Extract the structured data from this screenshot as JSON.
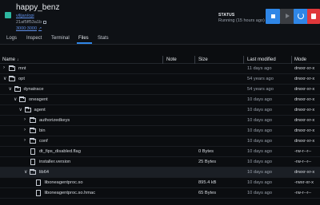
{
  "container": {
    "name": "happy_benz",
    "image": "vilijan/opi",
    "id": "21af5ff53a1b",
    "port": "3000:3000"
  },
  "status": {
    "label": "STATUS",
    "value": "Running (15 hours ago)"
  },
  "actions": {
    "stop": "stop-icon",
    "start": "play-icon",
    "restart": "restart-icon",
    "delete": "trash-icon"
  },
  "tabs": [
    "Logs",
    "Inspect",
    "Terminal",
    "Files",
    "Stats"
  ],
  "active_tab": "Files",
  "columns": {
    "name": "Name",
    "note": "Note",
    "size": "Size",
    "last_modified": "Last modified",
    "mode": "Mode"
  },
  "rows": [
    {
      "name": "mnt",
      "type": "folder",
      "expanded": false,
      "size": "",
      "modified": "11 days ago",
      "mode": "drwxr-xr-x"
    },
    {
      "name": "opt",
      "type": "folder",
      "expanded": true,
      "size": "",
      "modified": "54 years ago",
      "mode": "drwxr-xr-x"
    },
    {
      "name": "dynatrace",
      "type": "folder",
      "expanded": true,
      "size": "",
      "modified": "54 years ago",
      "mode": "drwxr-xr-x"
    },
    {
      "name": "oneagent",
      "type": "folder",
      "expanded": true,
      "size": "",
      "modified": "10 days ago",
      "mode": "drwxr-xr-x"
    },
    {
      "name": "agent",
      "type": "folder",
      "expanded": true,
      "size": "",
      "modified": "10 days ago",
      "mode": "drwxr-xr-x"
    },
    {
      "name": "authorizedkeys",
      "type": "folder",
      "expanded": false,
      "size": "",
      "modified": "10 days ago",
      "mode": "drwxr-xr-x"
    },
    {
      "name": "bin",
      "type": "folder",
      "expanded": false,
      "size": "",
      "modified": "10 days ago",
      "mode": "drwxr-xr-x"
    },
    {
      "name": "conf",
      "type": "folder",
      "expanded": false,
      "size": "",
      "modified": "10 days ago",
      "mode": "drwxr-xr-x"
    },
    {
      "name": "dt_fips_disabled.flag",
      "type": "file",
      "size": "0 Bytes",
      "modified": "10 days ago",
      "mode": "-rw-r--r--"
    },
    {
      "name": "installer.version",
      "type": "file",
      "size": "25 Bytes",
      "modified": "10 days ago",
      "mode": "-rw-r--r--"
    },
    {
      "name": "lib64",
      "type": "folder",
      "expanded": true,
      "size": "",
      "modified": "10 days ago",
      "mode": "drwxr-xr-x"
    },
    {
      "name": "liboneagentproc.so",
      "type": "file",
      "size": "895.4 kB",
      "modified": "10 days ago",
      "mode": "-rwxr-xr-x"
    },
    {
      "name": "liboneagentproc.so.hmac",
      "type": "file",
      "size": "65 Bytes",
      "modified": "10 days ago",
      "mode": "-rw-r--r--"
    }
  ]
}
